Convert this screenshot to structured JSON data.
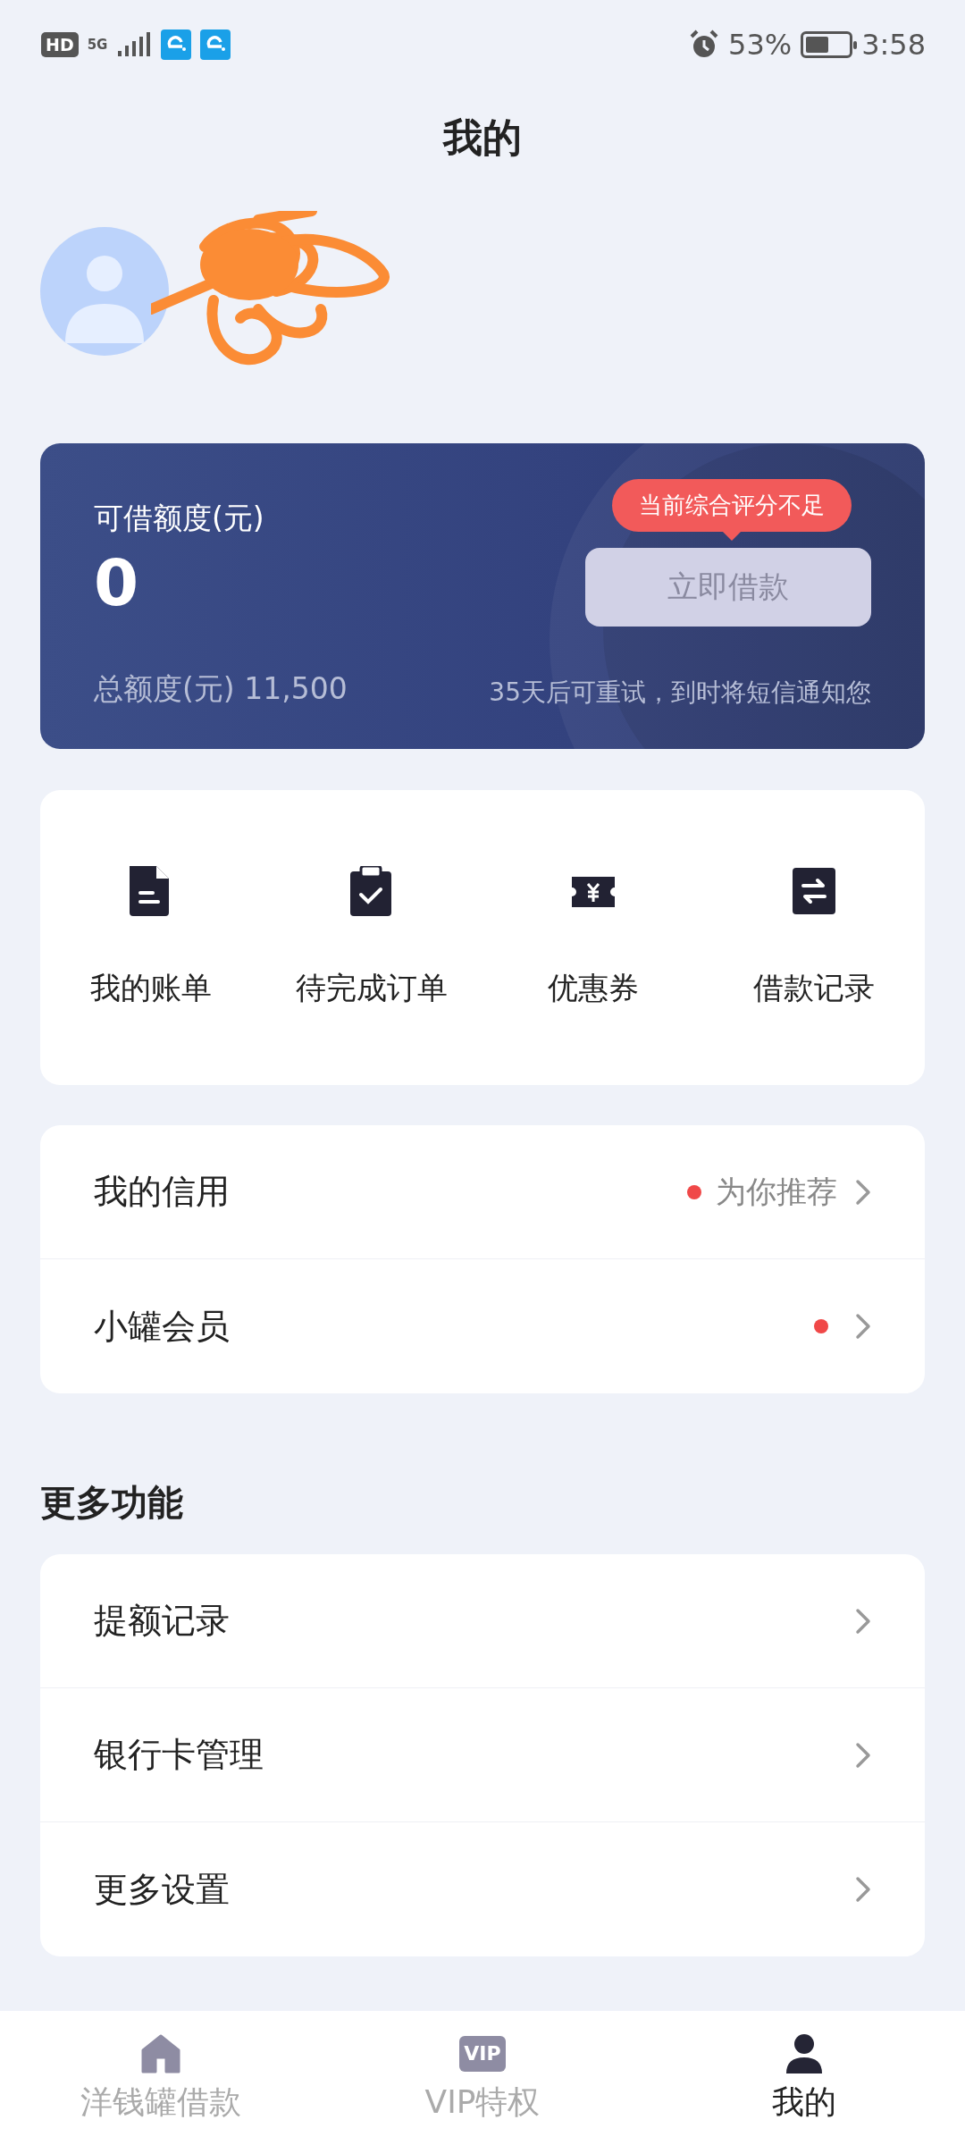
{
  "status_bar": {
    "hd": "HD",
    "network": "5G",
    "battery_text": "53%",
    "time": "3:58"
  },
  "header": {
    "title": "我的"
  },
  "profile": {
    "avatar": {
      "kind": "placeholder"
    },
    "name_redacted": true
  },
  "credit_card": {
    "label": "可借额度(元)",
    "amount": "0",
    "total": "总额度(元) 11,500",
    "tooltip": "当前综合评分不足",
    "button": {
      "label": "立即借款",
      "disabled": true
    },
    "note": "35天后可重试，到时将短信通知您"
  },
  "shortcuts": [
    {
      "kind": "bill",
      "label": "我的账单"
    },
    {
      "kind": "order",
      "label": "待完成订单"
    },
    {
      "kind": "coupon",
      "label": "优惠券"
    },
    {
      "kind": "loan",
      "label": "借款记录"
    }
  ],
  "account_list": [
    {
      "label": "我的信用",
      "hint": "为你推荐",
      "dot": true
    },
    {
      "label": "小罐会员",
      "dot": true
    }
  ],
  "more": {
    "title": "更多功能",
    "items": [
      {
        "label": "提额记录"
      },
      {
        "label": "银行卡管理"
      },
      {
        "label": "更多设置"
      }
    ]
  },
  "tab_bar": [
    {
      "kind": "home",
      "label": "洋钱罐借款",
      "selected": false
    },
    {
      "kind": "vip",
      "badge": "VIP",
      "label": "VIP特权",
      "selected": false
    },
    {
      "kind": "user",
      "label": "我的",
      "selected": true
    }
  ]
}
